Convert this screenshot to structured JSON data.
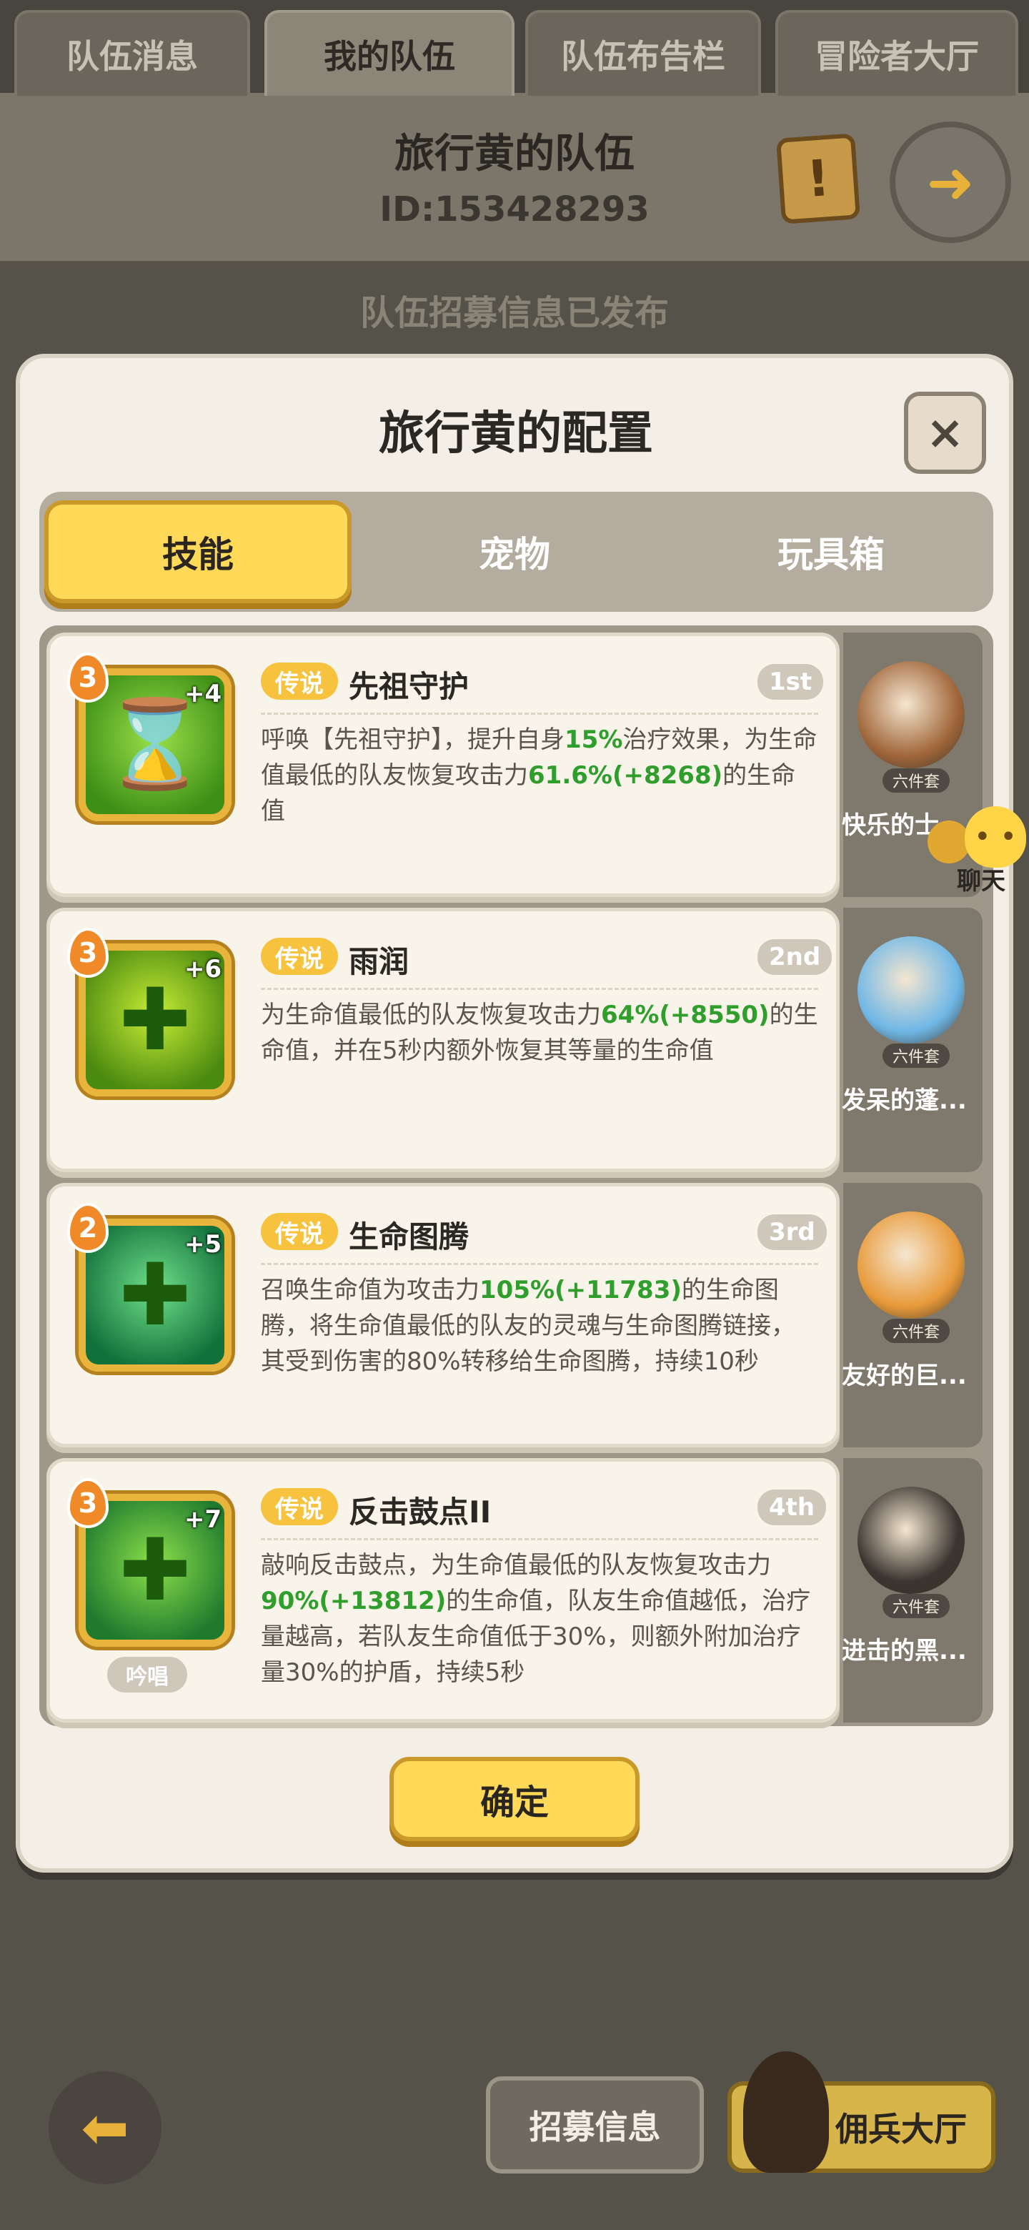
{
  "top_tabs": [
    {
      "label": "队伍消息",
      "active": false
    },
    {
      "label": "我的队伍",
      "active": true
    },
    {
      "label": "队伍布告栏",
      "active": false
    },
    {
      "label": "冒险者大厅",
      "active": false
    }
  ],
  "header": {
    "title": "旅行黄的队伍",
    "id_text": "ID:153428293",
    "notice_icon": "scroll-notice-icon",
    "exit_icon": "exit-door-icon"
  },
  "status": {
    "published": "队伍招募信息已发布"
  },
  "modal": {
    "title": "旅行黄的配置",
    "close_label": "×",
    "tabs": [
      {
        "label": "技能",
        "active": true
      },
      {
        "label": "宠物",
        "active": false
      },
      {
        "label": "玩具箱",
        "active": false
      }
    ],
    "skills": [
      {
        "level": "3",
        "plus": "+4",
        "rarity": "传说",
        "name": "先祖守护",
        "rank": "1st",
        "desc": [
          {
            "t": "呼唤【先祖守护】，提升自身"
          },
          {
            "t": "15%",
            "g": true
          },
          {
            "t": "治疗效果，为生命值最低的队友恢复攻击力"
          },
          {
            "t": "61.6%(+8268)",
            "g": true
          },
          {
            "t": "的生命值"
          }
        ],
        "color_a": "#9be04a",
        "color_b": "#3e8f16",
        "glyph": "⌛"
      },
      {
        "level": "3",
        "plus": "+6",
        "rarity": "传说",
        "name": "雨润",
        "rank": "2nd",
        "desc": [
          {
            "t": "为生命值最低的队友恢复攻击力"
          },
          {
            "t": "64%(+8550)",
            "g": true
          },
          {
            "t": "的生命值，并在5秒内额外恢复其等量的生命值"
          }
        ],
        "color_a": "#c7ec35",
        "color_b": "#4b8a10",
        "glyph": "✚"
      },
      {
        "level": "2",
        "plus": "+5",
        "rarity": "传说",
        "name": "生命图腾",
        "rank": "3rd",
        "desc": [
          {
            "t": "召唤生命值为攻击力"
          },
          {
            "t": "105%(+11783)",
            "g": true
          },
          {
            "t": "的生命图腾，将生命值最低的队友的灵魂与生命图腾链接，其受到伤害的80%转移给生命图腾，持续10秒"
          }
        ],
        "color_a": "#6fe08a",
        "color_b": "#12703a",
        "glyph": "✚"
      },
      {
        "level": "3",
        "plus": "+7",
        "rarity": "传说",
        "name": "反击鼓点II",
        "rank": "4th",
        "tag": "吟唱",
        "desc": [
          {
            "t": "敲响反击鼓点，为生命值最低的队友恢复攻击力"
          },
          {
            "t": "90%(+13812)",
            "g": true
          },
          {
            "t": "的生命值，队友生命值越低，治疗量越高，若队友生命值低于30%，则额外附加治疗量30%的护盾，持续5秒"
          }
        ],
        "color_a": "#8ce04a",
        "color_b": "#1f7a2e",
        "glyph": "✚"
      }
    ],
    "pets": [
      {
        "name": "快乐的士",
        "badge": "六件套",
        "color": "#a0663a"
      },
      {
        "name": "发呆的蓬...",
        "badge": "六件套",
        "color": "#6fb7e6"
      },
      {
        "name": "友好的巨...",
        "badge": "六件套",
        "color": "#e89a3a"
      },
      {
        "name": "进击的黑...",
        "badge": "六件套",
        "color": "#3a3530"
      }
    ],
    "confirm_label": "确定"
  },
  "chat": {
    "label": "聊天"
  },
  "bottom": {
    "recruit_label": "招募信息",
    "hall_label": "佣兵大厅",
    "back_icon": "back-arrow-icon"
  }
}
